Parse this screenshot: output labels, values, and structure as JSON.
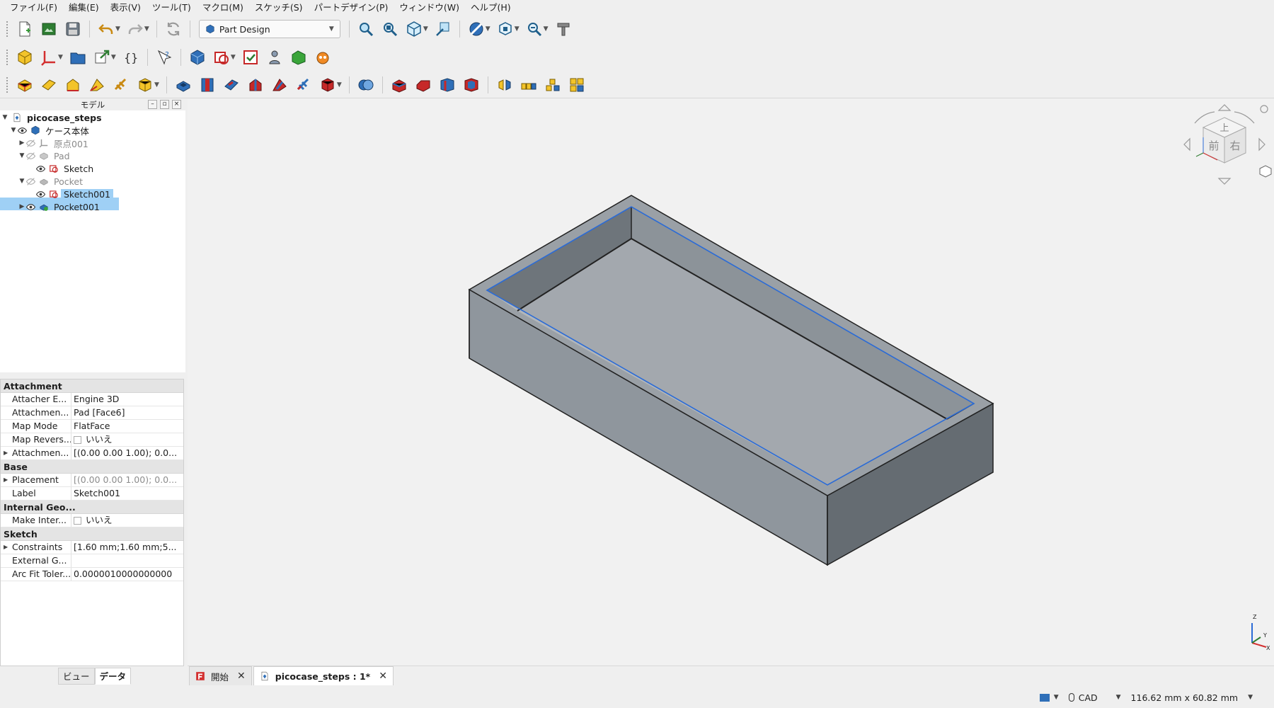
{
  "menu": [
    "ファイル(F)",
    "編集(E)",
    "表示(V)",
    "ツール(T)",
    "マクロ(M)",
    "スケッチ(S)",
    "パートデザイン(P)",
    "ウィンドウ(W)",
    "ヘルプ(H)"
  ],
  "workbench": {
    "selected": "Part Design"
  },
  "tree": {
    "header": "モデル",
    "items": [
      {
        "label": "picocase_steps",
        "bold": true
      },
      {
        "label": "ケース本体"
      },
      {
        "label": "原点001"
      },
      {
        "label": "Pad"
      },
      {
        "label": "Sketch"
      },
      {
        "label": "Pocket"
      },
      {
        "label": "Sketch001"
      },
      {
        "label": "Pocket001"
      }
    ]
  },
  "properties": {
    "groups": [
      {
        "title": "Attachment",
        "rows": [
          {
            "name": "Attacher E...",
            "value": "Engine 3D"
          },
          {
            "name": "Attachmen...",
            "value": "Pad [Face6]"
          },
          {
            "name": "Map Mode",
            "value": "FlatFace"
          },
          {
            "name": "Map Revers...",
            "value": "いいえ",
            "checkbox": true
          },
          {
            "name": "Attachmen...",
            "value": "[(0.00 0.00 1.00); 0.0...",
            "expand": true
          }
        ]
      },
      {
        "title": "Base",
        "rows": [
          {
            "name": "Placement",
            "value": "[(0.00 0.00 1.00); 0.0...",
            "expand": true,
            "dim": true
          },
          {
            "name": "Label",
            "value": "Sketch001"
          }
        ]
      },
      {
        "title": "Internal Geo...",
        "rows": [
          {
            "name": "Make Inter...",
            "value": "いいえ",
            "checkbox": true
          }
        ]
      },
      {
        "title": "Sketch",
        "rows": [
          {
            "name": "Constraints",
            "value": "[1.60 mm;1.60 mm;5...",
            "expand": true
          },
          {
            "name": "External G...",
            "value": ""
          },
          {
            "name": "Arc Fit Toler...",
            "value": "0.0000010000000000"
          }
        ]
      }
    ]
  },
  "left_tabs": [
    "ビュー",
    "データ"
  ],
  "navcube": {
    "top": "上",
    "front": "前",
    "right": "右"
  },
  "axes": {
    "x": "X",
    "y": "Y",
    "z": "Z"
  },
  "doc_tabs": [
    {
      "label": "開始"
    },
    {
      "label": "picocase_steps : 1*"
    }
  ],
  "status": {
    "nav_style": "CAD",
    "dimensions": "116.62 mm x 60.82 mm"
  },
  "colors": {
    "accent_blue": "#2b6bd6",
    "selection": "#9fd0f5",
    "model_face": "#8f969d"
  }
}
